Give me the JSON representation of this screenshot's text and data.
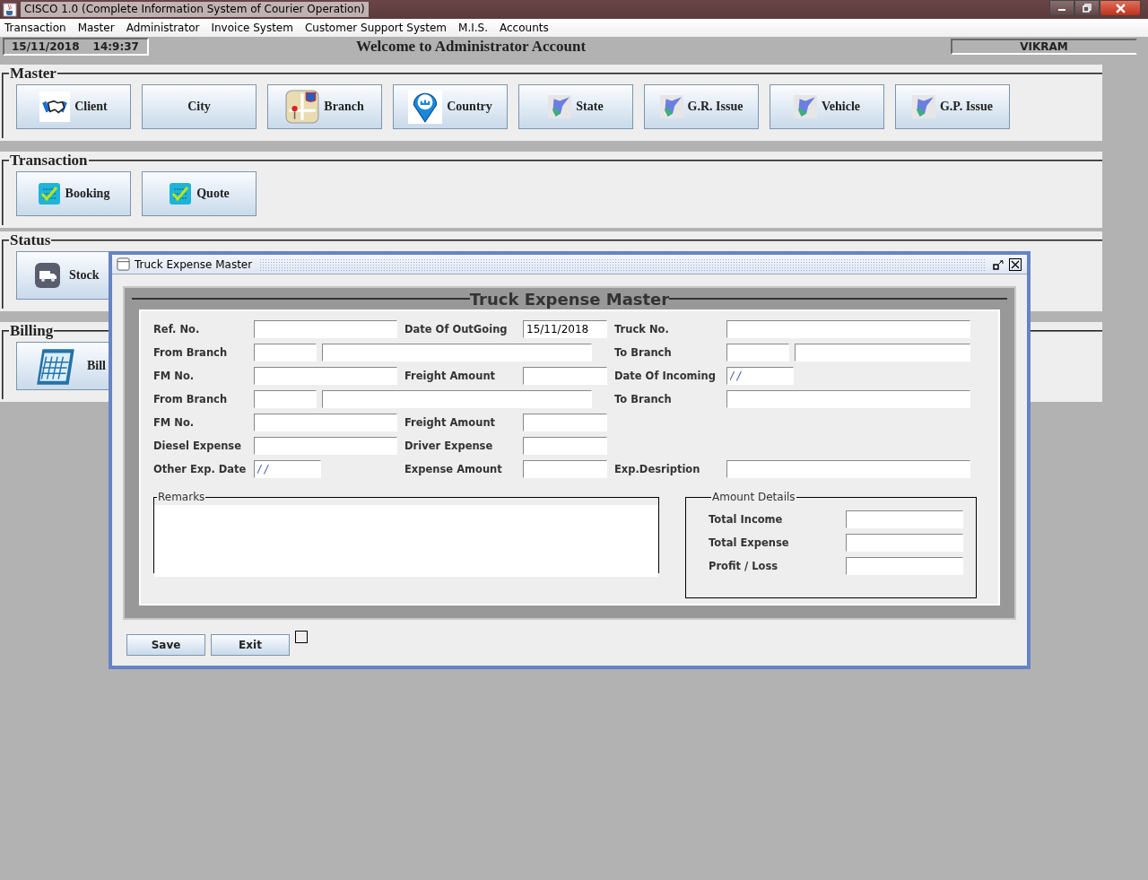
{
  "window": {
    "title": "CISCO 1.0 (Complete Information System of Courier Operation)"
  },
  "menu": [
    "Transaction",
    "Master",
    "Administrator",
    "Invoice System",
    "Customer Support System",
    "M.I.S.",
    "Accounts"
  ],
  "info_bar": {
    "date": "15/11/2018",
    "time": "14:9:37",
    "welcome": "Welcome to Administrator Account",
    "user": "VIKRAM"
  },
  "sections": [
    {
      "title": "Master",
      "buttons": [
        {
          "label": "Client",
          "kind": "handshake"
        },
        {
          "label": "City",
          "kind": "plain"
        },
        {
          "label": "Branch",
          "kind": "map"
        },
        {
          "label": "Country",
          "kind": "pin"
        },
        {
          "label": "State",
          "kind": "region"
        },
        {
          "label": "G.R. Issue",
          "kind": "region"
        },
        {
          "label": "Vehicle",
          "kind": "region"
        },
        {
          "label": "G.P. Issue",
          "kind": "region"
        }
      ]
    },
    {
      "title": "Transaction",
      "buttons": [
        {
          "label": "Booking",
          "kind": "checklist"
        },
        {
          "label": "Quote",
          "kind": "checklist"
        }
      ]
    },
    {
      "title": "Status",
      "buttons": [
        {
          "label": "Stock",
          "kind": "truck"
        }
      ]
    },
    {
      "title": "Billing",
      "buttons": [
        {
          "label": "Bill",
          "kind": "calendar"
        }
      ]
    }
  ],
  "dialog": {
    "title": "Truck Expense Master",
    "heading": "Truck Expense Master",
    "rows": [
      [
        {
          "label": "Ref. No.",
          "fields": [
            {
              "kind": "text"
            }
          ]
        },
        {
          "label": "Date Of OutGoing",
          "fields": [
            {
              "kind": "text",
              "value": "15/11/2018"
            }
          ]
        },
        {
          "label": "Truck No.",
          "fields": [
            {
              "kind": "text"
            }
          ]
        }
      ],
      [
        {
          "label": "From Branch",
          "fields": [
            {
              "kind": "text"
            },
            {
              "kind": "text"
            }
          ]
        },
        {
          "label": "To Branch",
          "fields": [
            {
              "kind": "text"
            },
            {
              "kind": "text"
            }
          ]
        }
      ],
      [
        {
          "label": "FM No.",
          "fields": [
            {
              "kind": "text"
            }
          ]
        },
        {
          "label": "Freight Amount",
          "fields": [
            {
              "kind": "text"
            }
          ]
        },
        {
          "label": "Date Of Incoming",
          "fields": [
            {
              "kind": "date",
              "value": "/ /"
            }
          ]
        }
      ],
      [
        {
          "label": "From Branch",
          "fields": [
            {
              "kind": "text"
            },
            {
              "kind": "text"
            }
          ]
        },
        {
          "label": "To Branch",
          "fields": [
            {
              "kind": "text"
            }
          ]
        }
      ],
      [
        {
          "label": "FM No.",
          "fields": [
            {
              "kind": "text"
            }
          ]
        },
        {
          "label": "Freight Amount",
          "fields": [
            {
              "kind": "text"
            }
          ]
        }
      ],
      [
        {
          "label": "Diesel Expense",
          "fields": [
            {
              "kind": "text"
            }
          ]
        },
        {
          "label": "Driver Expense",
          "fields": [
            {
              "kind": "text"
            }
          ]
        }
      ],
      [
        {
          "label": "Other Exp. Date",
          "fields": [
            {
              "kind": "date",
              "value": "/ /"
            }
          ]
        },
        {
          "label": "Expense Amount",
          "fields": [
            {
              "kind": "text"
            }
          ]
        },
        {
          "label": "Exp.Desription",
          "fields": [
            {
              "kind": "text"
            }
          ]
        }
      ]
    ],
    "remarks": {
      "label": "Remarks"
    },
    "amount_details": {
      "title": "Amount Details",
      "rows": [
        {
          "label": "Total Income"
        },
        {
          "label": "Total Expense"
        },
        {
          "label": "Profit / Loss"
        }
      ]
    },
    "buttons": [
      "Save",
      "Exit"
    ],
    "checkbox": {
      "checked": false
    }
  }
}
